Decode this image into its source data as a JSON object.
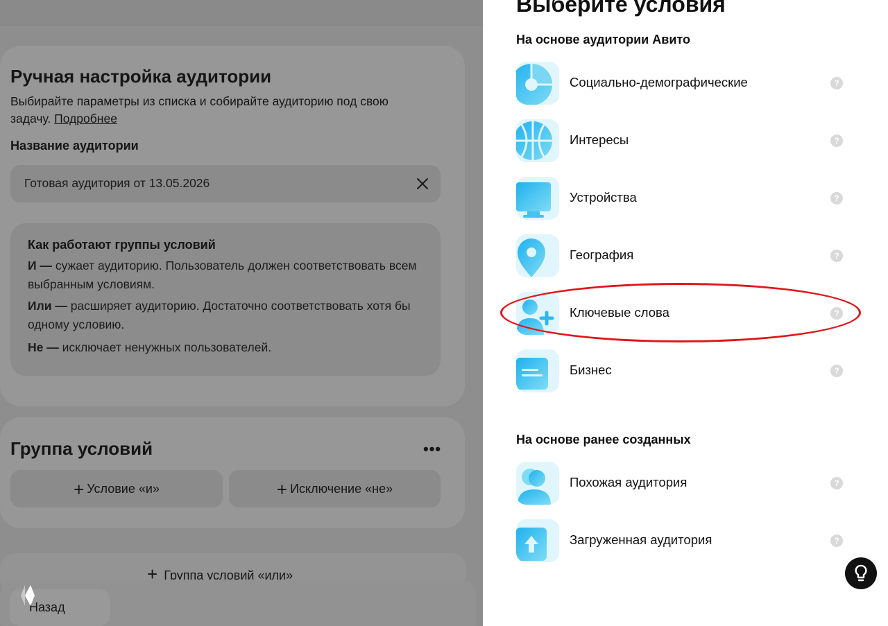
{
  "left": {
    "manual": {
      "title": "Ручная настройка аудитории",
      "description": "Выбирайте параметры из списка и собирайте аудиторию под свою задачу.",
      "more_link": "Подробнее",
      "name_label": "Название аудитории",
      "name_value": "Готовая аудитория от 13.05.2026"
    },
    "info": {
      "title": "Как работают группы условий",
      "and_key": "И —",
      "and_text": " сужает аудиторию. Пользователь должен соответствовать всем выбранным условиям.",
      "or_key": "Или —",
      "or_text": " расширяет аудиторию. Достаточно соответствовать хотя бы одному условию.",
      "not_key": "Не —",
      "not_text": " исключает ненужных пользователей."
    },
    "group": {
      "title": "Группа условий",
      "more": "•••",
      "add_and": "Условие «и»",
      "add_not": "Исключение «не»",
      "add_or_group": "Группа условий «или»"
    },
    "back_label": "Назад"
  },
  "panel": {
    "title": "Выберите условия",
    "section_avito": "На основе аудитории Авито",
    "section_created": "На основе ранее созданных",
    "help_glyph": "?",
    "items_avito": [
      {
        "label": "Социально-демографические",
        "icon": "pie-chart-icon"
      },
      {
        "label": "Интересы",
        "icon": "basketball-icon"
      },
      {
        "label": "Устройства",
        "icon": "monitor-icon"
      },
      {
        "label": "География",
        "icon": "map-pin-icon"
      },
      {
        "label": "Ключевые слова",
        "icon": "user-plus-icon",
        "highlighted": true
      },
      {
        "label": "Бизнес",
        "icon": "document-icon"
      }
    ],
    "items_created": [
      {
        "label": "Похожая аудитория",
        "icon": "users-icon"
      },
      {
        "label": "Загруженная аудитория",
        "icon": "upload-icon"
      }
    ]
  },
  "colors": {
    "overlay_gray": "#8e8e8e",
    "tile_bg": "#e0f6fc",
    "icon_gradient_start": "#2fb7ef",
    "icon_gradient_end": "#7fdcf5",
    "highlight_red": "#e3141c"
  }
}
